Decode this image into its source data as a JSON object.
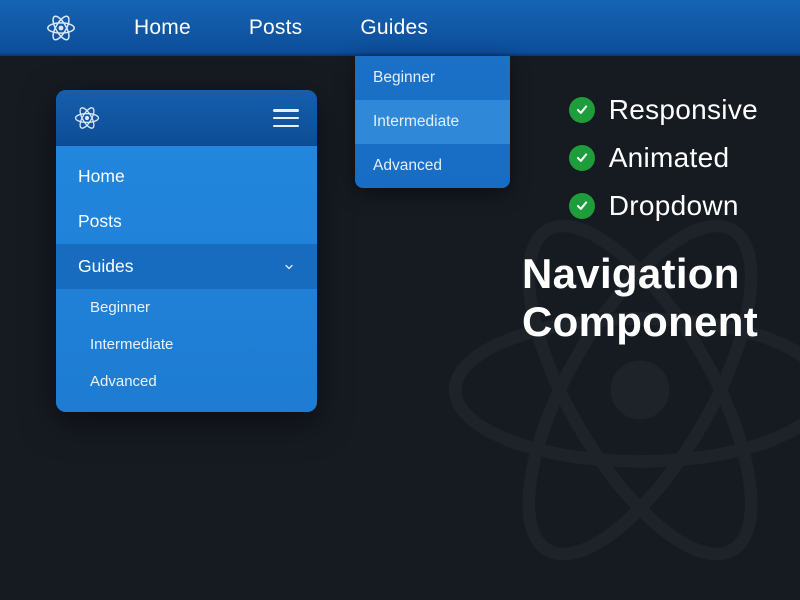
{
  "topnav": {
    "items": [
      "Home",
      "Posts",
      "Guides"
    ]
  },
  "dropdown": {
    "items": [
      "Beginner",
      "Intermediate",
      "Advanced"
    ],
    "selected_index": 1
  },
  "mobile": {
    "items": [
      "Home",
      "Posts",
      "Guides"
    ],
    "selected_index": 2,
    "sub_items": [
      "Beginner",
      "Intermediate",
      "Advanced"
    ]
  },
  "features": {
    "items": [
      "Responsive",
      "Animated",
      "Dropdown"
    ]
  },
  "title": {
    "line1": "Navigation",
    "line2": "Component"
  }
}
